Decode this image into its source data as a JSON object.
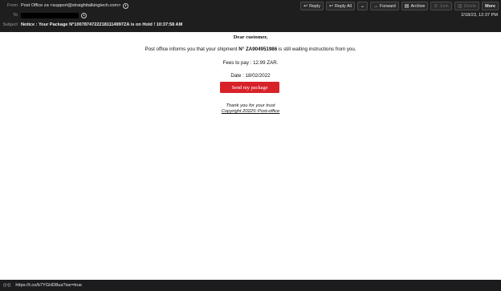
{
  "header": {
    "from_label": "From",
    "from_value": "Post Office za <support@straighttalkingtech.com>",
    "to_label": "To",
    "subject_label": "Subject",
    "subject_value": "Notice : Your Package N°10078747222181114997ZA is on Hold ! 10:37:58 AM",
    "date": "2/18/23, 12:37 PM"
  },
  "toolbar": {
    "reply": "Reply",
    "reply_all": "Reply All",
    "forward": "Forward",
    "archive": "Archive",
    "junk": "Junk",
    "delete": "Delete",
    "more": "More"
  },
  "message": {
    "greeting": "Dear customer,",
    "line1_prefix": "Post office informs you that your shipment ",
    "shipment_number": "N° ZA904951986",
    "line1_suffix": " is still waiting instructions from you.",
    "fees": "Fees to pay : 12.99 ZAR.",
    "date_line": "Date : 18/02/2022",
    "button_label": "Send my package",
    "thanks": "Thank you for your trust",
    "copyright": "Copyright 2022© Post-office"
  },
  "statusbar": {
    "url": "https://t.co/b7YGHD8ua?ssr=true"
  },
  "colors": {
    "button_red": "#d8222a",
    "header_bg": "#1e1e1e"
  }
}
